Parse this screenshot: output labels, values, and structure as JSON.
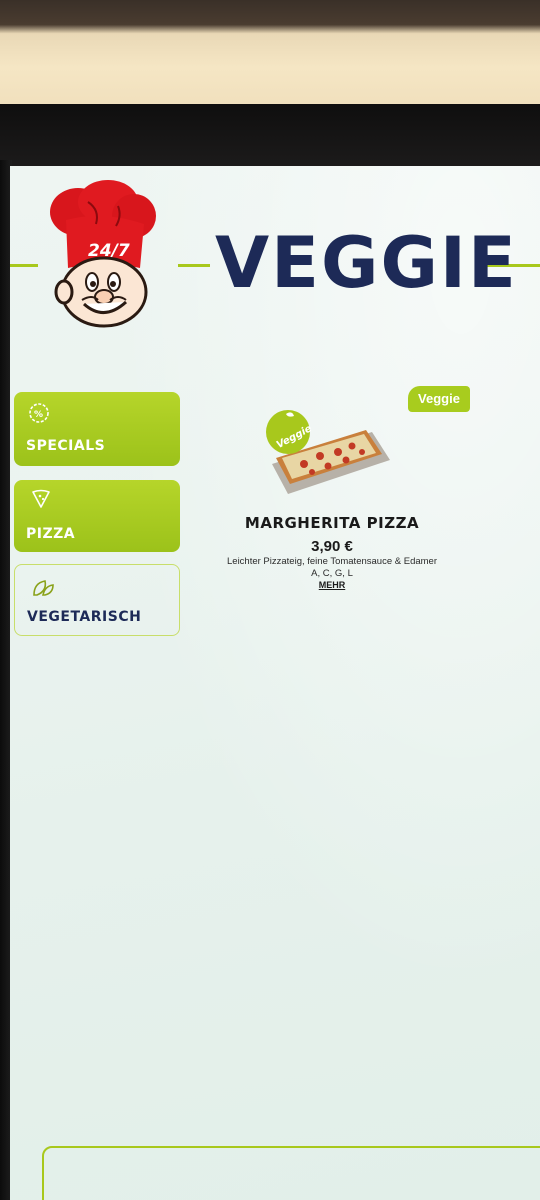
{
  "header": {
    "mascot_badge": "24/7",
    "title": "VEGGIE"
  },
  "sidebar": {
    "items": [
      {
        "label": "SPECIALS",
        "icon": "specials-icon",
        "active": true
      },
      {
        "label": "PIZZA",
        "icon": "pizza-slice-icon",
        "active": true
      },
      {
        "label": "VEGETARISCH",
        "icon": "leaf-icon",
        "active": false
      }
    ]
  },
  "product": {
    "badge": "Veggie",
    "image_stamp": "Veggie",
    "name": "MARGHERITA PIZZA",
    "price": "3,90 €",
    "description": "Leichter Pizzateig, feine Tomatensauce & Edamer",
    "allergens": "A, C, G, L",
    "more_link": "MEHR"
  },
  "colors": {
    "accent_green": "#a8c81c",
    "title_navy": "#1d2a57",
    "screen_bg": "#eaf3ef"
  }
}
